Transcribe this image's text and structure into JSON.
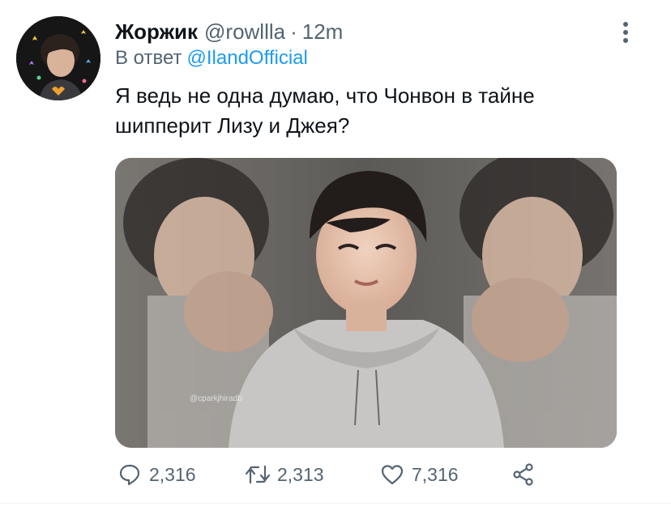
{
  "tweet": {
    "author": {
      "display_name": "Жоржик",
      "handle": "@rowllla",
      "time": "12m",
      "avatar_icon": "user-avatar"
    },
    "reply_to": {
      "label": "В ответ",
      "mention": "@IlandOfficial"
    },
    "text": "Я ведь не одна думаю, что Чонвон в тайне шипперит Лизу и Джея?",
    "media": {
      "type": "photo",
      "watermark": "@cparkjhiradb"
    },
    "actions": {
      "reply": {
        "icon": "reply-icon",
        "count": "2,316"
      },
      "retweet": {
        "icon": "retweet-icon",
        "count": "2,313"
      },
      "like": {
        "icon": "heart-icon",
        "count": "7,316"
      },
      "share": {
        "icon": "share-icon"
      }
    }
  },
  "colors": {
    "text": "#0f1419",
    "secondary": "#536471",
    "link": "#1d9bf0",
    "divider": "#eff3f4"
  }
}
